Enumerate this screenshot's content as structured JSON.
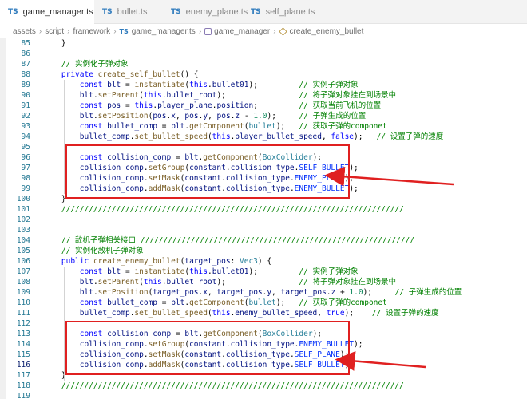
{
  "tabs": [
    {
      "lang": "TS",
      "label": "game_manager.ts",
      "active": true,
      "modified": true
    },
    {
      "lang": "TS",
      "label": "bullet.ts",
      "active": false,
      "modified": false
    },
    {
      "lang": "TS",
      "label": "enemy_plane.ts",
      "active": false,
      "modified": false
    },
    {
      "lang": "TS",
      "label": "self_plane.ts",
      "active": false,
      "modified": false
    }
  ],
  "breadcrumb": {
    "items": [
      "assets",
      "script",
      "framework"
    ],
    "file_lang": "TS",
    "file": "game_manager.ts",
    "class_name": "game_manager",
    "method": "create_enemy_bullet"
  },
  "code_lines": [
    {
      "n": "85",
      "text": "    }"
    },
    {
      "n": "86",
      "text": ""
    },
    {
      "n": "87",
      "text": "    // 实例化子弹对象"
    },
    {
      "n": "88",
      "text": "    private create_self_bullet() {"
    },
    {
      "n": "89",
      "text": "        const blt = instantiate(this.bullet01);         // 实例子弹对象"
    },
    {
      "n": "90",
      "text": "        blt.setParent(this.bullet_root);                // 将子弹对象挂在到场景中"
    },
    {
      "n": "91",
      "text": "        const pos = this.player_plane.position;         // 获取当前飞机的位置"
    },
    {
      "n": "92",
      "text": "        blt.setPosition(pos.x, pos.y, pos.z - 1.0);     // 子弹生成的位置"
    },
    {
      "n": "93",
      "text": "        const bullet_comp = blt.getComponent(bullet);   // 获取子弹的componet"
    },
    {
      "n": "94",
      "text": "        bullet_comp.set_bullet_speed(this.player_bullet_speed, false);   // 设置子弹的速度"
    },
    {
      "n": "95",
      "text": ""
    },
    {
      "n": "96",
      "text": "        const collision_comp = blt.getComponent(BoxCollider);"
    },
    {
      "n": "97",
      "text": "        collision_comp.setGroup(constant.collision_type.SELF_BULLET);"
    },
    {
      "n": "98",
      "text": "        collision_comp.setMask(constant.collision_type.ENEMY_PLANE);"
    },
    {
      "n": "99",
      "text": "        collision_comp.addMask(constant.collision_type.ENEMY_BULLET);"
    },
    {
      "n": "100",
      "text": "    }"
    },
    {
      "n": "101",
      "text": "    ///////////////////////////////////////////////////////////////////////////"
    },
    {
      "n": "102",
      "text": ""
    },
    {
      "n": "103",
      "text": ""
    },
    {
      "n": "104",
      "text": "    // 敌机子弹相关接口 ////////////////////////////////////////////////////////////"
    },
    {
      "n": "105",
      "text": "    // 实例化敌机子弹对象"
    },
    {
      "n": "106",
      "text": "    public create_enemy_bullet(target_pos: Vec3) {"
    },
    {
      "n": "107",
      "text": "        const blt = instantiate(this.bullet01);         // 实例子弹对象"
    },
    {
      "n": "108",
      "text": "        blt.setParent(this.bullet_root);                // 将子弹对象挂在到场景中"
    },
    {
      "n": "109",
      "text": "        blt.setPosition(target_pos.x, target_pos.y, target_pos.z + 1.0);     // 子弹生成的位置"
    },
    {
      "n": "110",
      "text": "        const bullet_comp = blt.getComponent(bullet);   // 获取子弹的componet"
    },
    {
      "n": "111",
      "text": "        bullet_comp.set_bullet_speed(this.enemy_bullet_speed, true);    // 设置子弹的速度"
    },
    {
      "n": "112",
      "text": ""
    },
    {
      "n": "113",
      "text": "        const collision_comp = blt.getComponent(BoxCollider);"
    },
    {
      "n": "114",
      "text": "        collision_comp.setGroup(constant.collision_type.ENEMY_BULLET);"
    },
    {
      "n": "115",
      "text": "        collision_comp.setMask(constant.collision_type.SELF_PLANE);"
    },
    {
      "n": "116",
      "text": "        collision_comp.addMask(constant.collision_type.SELF_BULLET);"
    },
    {
      "n": "117",
      "text": "    }"
    },
    {
      "n": "118",
      "text": "    ///////////////////////////////////////////////////////////////////////////"
    },
    {
      "n": "119",
      "text": ""
    }
  ],
  "current_line": "116",
  "highlighted_blocks": [
    {
      "from": "96",
      "to": "99"
    },
    {
      "from": "113",
      "to": "116"
    }
  ],
  "colors": {
    "keyword": "#0000ff",
    "comment": "#008000",
    "function": "#795e26",
    "variable": "#001080",
    "type": "#267f99",
    "number": "#098658",
    "annotation": "#e02020"
  }
}
